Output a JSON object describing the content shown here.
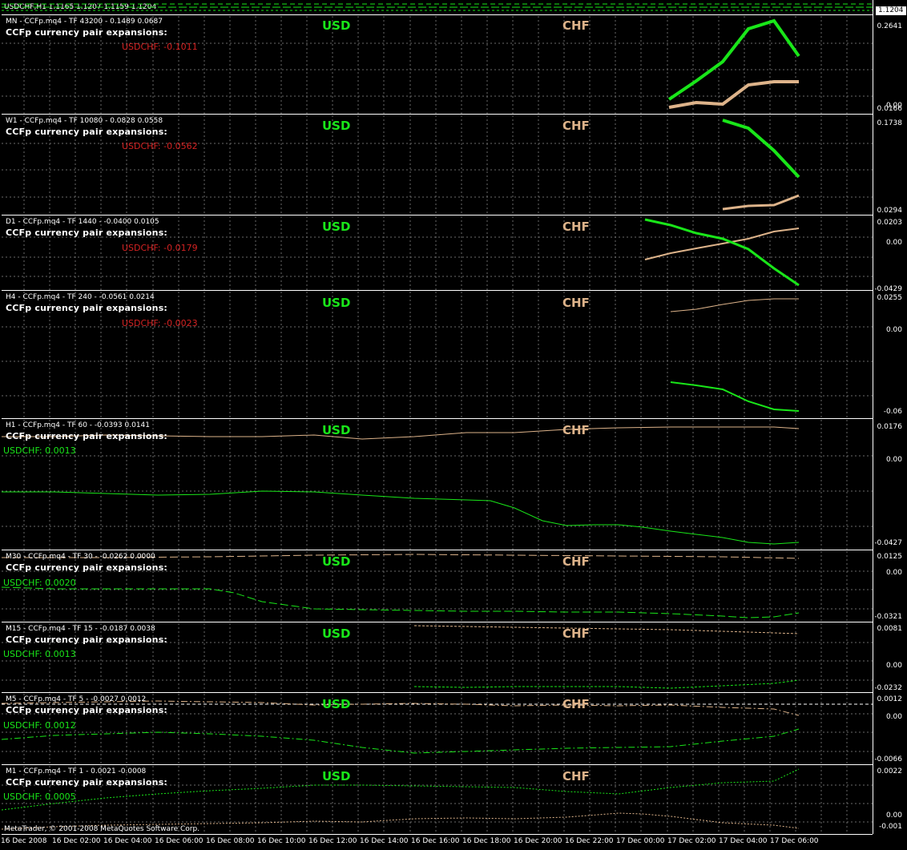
{
  "main": {
    "title": "USDCHF,H1  1.1165 1.1207 1.1159 1.1204",
    "price_box": "1.1204"
  },
  "subheader": "CCFp currency pair expansions:",
  "labels": {
    "usd": "USD",
    "chf": "CHF"
  },
  "colors": {
    "usd": "#19e619",
    "chf": "#ddb38a",
    "neg": "#d42222",
    "pos": "#19e619"
  },
  "panels": [
    {
      "header": "MN - CCFp.mq4 - TF 43200 - 0.1489 0.0687",
      "pair_text": "USDCHF: -0.1011",
      "pair_sign": "neg",
      "levels": [
        "0.2641",
        "0.00",
        "0.0166"
      ]
    },
    {
      "header": "W1 - CCFp.mq4 - TF 10080 - 0.0828 0.0558",
      "pair_text": "USDCHF: -0.0562",
      "pair_sign": "neg",
      "levels": [
        "0.1738",
        "0.0294"
      ]
    },
    {
      "header": "D1 - CCFp.mq4 - TF 1440 - -0.0400 0.0105",
      "pair_text": "USDCHF: -0.0179",
      "pair_sign": "neg",
      "levels": [
        "0.0203",
        "0.00",
        "-0.0429"
      ]
    },
    {
      "header": "H4 - CCFp.mq4 - TF 240 - -0.0561 0.0214",
      "pair_text": "USDCHF: -0.0023",
      "pair_sign": "neg",
      "levels": [
        "0.0255",
        "0.00",
        "-0.06"
      ]
    },
    {
      "header": "H1 - CCFp.mq4 - TF 60 - -0.0393 0.0141",
      "pair_text": "USDCHF: 0.0013",
      "pair_sign": "pos",
      "levels": [
        "0.0176",
        "0.00",
        "-0.0427"
      ]
    },
    {
      "header": "M30 - CCFp.mq4 - TF 30 - -0.0262 0.0000",
      "pair_text": "USDCHF: 0.0020",
      "pair_sign": "pos",
      "levels": [
        "0.0125",
        "0.00",
        "-0.0321"
      ]
    },
    {
      "header": "M15 - CCFp.mq4 - TF 15 - -0.0187 0.0038",
      "pair_text": "USDCHF: 0.0013",
      "pair_sign": "pos",
      "levels": [
        "0.0081",
        "0.00",
        "-0.0232"
      ]
    },
    {
      "header": "M5 - CCFp.mq4 - TF 5 - -0.0027 0.0012",
      "pair_text": "USDCHF: 0.0012",
      "pair_sign": "pos",
      "levels": [
        "0.0012",
        "0.00",
        "-0.0066"
      ]
    },
    {
      "header": "M1 - CCFp.mq4 - TF 1 - 0.0021 -0.0008",
      "pair_text": "USDCHF: 0.0005",
      "pair_sign": "pos",
      "levels": [
        "0.0022",
        "0.00",
        "-0.001"
      ]
    }
  ],
  "time_axis": [
    "16 Dec 2008",
    "16 Dec 02:00",
    "16 Dec 04:00",
    "16 Dec 06:00",
    "16 Dec 08:00",
    "16 Dec 10:00",
    "16 Dec 12:00",
    "16 Dec 14:00",
    "16 Dec 16:00",
    "16 Dec 18:00",
    "16 Dec 20:00",
    "16 Dec 22:00",
    "17 Dec 00:00",
    "17 Dec 02:00",
    "17 Dec 04:00",
    "17 Dec 06:00"
  ],
  "copyright": "MetaTrader, © 2001-2008 MetaQuotes Software Corp."
}
